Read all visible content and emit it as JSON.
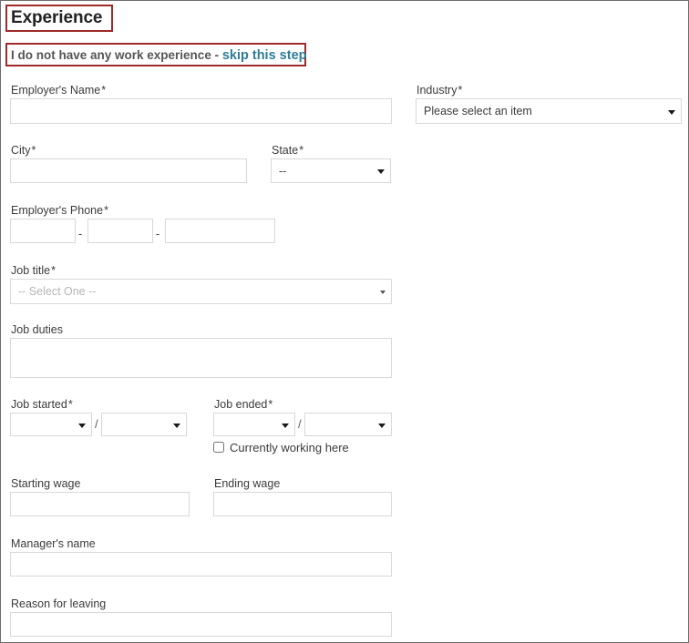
{
  "page": {
    "title": "Experience"
  },
  "skip": {
    "text": "I do not have any work experience - ",
    "link_label": "skip this step"
  },
  "fields": {
    "employer_name": {
      "label": "Employer's Name",
      "required_mark": "*",
      "value": "",
      "placeholder": ""
    },
    "industry": {
      "label": "Industry",
      "required_mark": "*",
      "selected": "Please select an item"
    },
    "city": {
      "label": "City",
      "required_mark": "*",
      "value": "",
      "placeholder": ""
    },
    "state": {
      "label": "State",
      "required_mark": "*",
      "selected": "--"
    },
    "employer_phone": {
      "label": "Employer's Phone",
      "required_mark": "*",
      "area_code": "",
      "prefix": "",
      "line_number": "",
      "separator": "-"
    },
    "job_title": {
      "label": "Job title",
      "required_mark": "*",
      "selected": "-- Select One --"
    },
    "job_duties": {
      "label": "Job duties",
      "required_mark": "",
      "value": ""
    },
    "job_started": {
      "label": "Job started",
      "required_mark": "*",
      "month": "",
      "year": "",
      "separator": "/"
    },
    "job_ended": {
      "label": "Job ended",
      "required_mark": "*",
      "month": "",
      "year": "",
      "separator": "/"
    },
    "currently_working": {
      "label": "Currently working here",
      "checked": false
    },
    "starting_wage": {
      "label": "Starting wage",
      "required_mark": "",
      "value": ""
    },
    "ending_wage": {
      "label": "Ending wage",
      "required_mark": "",
      "value": ""
    },
    "manager_name": {
      "label": "Manager's name",
      "required_mark": "",
      "value": ""
    },
    "reason_for_leaving": {
      "label": "Reason for leaving",
      "required_mark": "",
      "value": ""
    }
  },
  "colors": {
    "annotation_red": "#9e2a2b",
    "link_teal": "#2e7d96",
    "label_text": "#3b3b3b",
    "field_border": "#d8d8d8"
  }
}
